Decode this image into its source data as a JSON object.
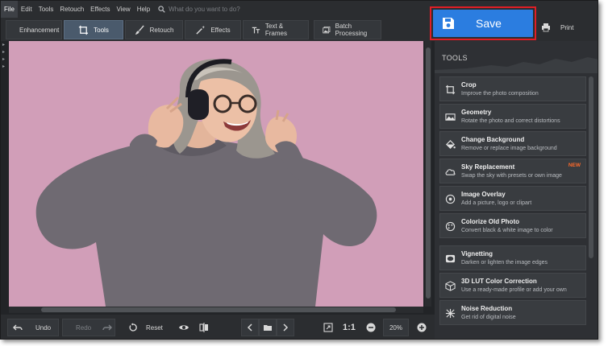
{
  "menu": {
    "items": [
      "File",
      "Edit",
      "Tools",
      "Retouch",
      "Effects",
      "View",
      "Help"
    ],
    "active": "File",
    "search_placeholder": "What do you want to do?"
  },
  "tabs": [
    {
      "label": "Enhancement",
      "icon": "sliders-icon"
    },
    {
      "label": "Tools",
      "icon": "crop-icon",
      "active": true
    },
    {
      "label": "Retouch",
      "icon": "brush-icon"
    },
    {
      "label": "Effects",
      "icon": "magic-wand-icon"
    },
    {
      "label": "Text & Frames",
      "icon": "text-icon"
    },
    {
      "label": "Batch Processing",
      "icon": "image-stack-icon"
    }
  ],
  "save": {
    "label": "Save",
    "icon": "floppy-disk-icon",
    "highlight_color": "#e01e26",
    "color": "#2b7de0"
  },
  "print": {
    "label": "Print",
    "icon": "printer-icon"
  },
  "panel": {
    "title": "TOOLS",
    "tools": [
      {
        "title": "Crop",
        "desc": "Improve the photo composition",
        "icon": "crop-icon"
      },
      {
        "title": "Geometry",
        "desc": "Rotate the photo and correct distortions",
        "icon": "geometry-icon"
      },
      {
        "title": "Change Background",
        "desc": "Remove or replace image background",
        "icon": "paint-bucket-icon"
      },
      {
        "title": "Sky Replacement",
        "desc": "Swap the sky with presets or own image",
        "icon": "cloud-icon",
        "badge": "NEW"
      },
      {
        "title": "Image Overlay",
        "desc": "Add a picture, logo or clipart",
        "icon": "overlay-icon"
      },
      {
        "title": "Colorize Old Photo",
        "desc": "Convert black & white image to color",
        "icon": "colorize-icon"
      },
      {
        "title": "Vignetting",
        "desc": "Darken or lighten the image edges",
        "icon": "vignette-icon"
      },
      {
        "title": "3D LUT Color Correction",
        "desc": "Use a ready-made profile or add your own",
        "icon": "lut-cube-icon"
      },
      {
        "title": "Noise Reduction",
        "desc": "Get rid of digital noise",
        "icon": "noise-icon"
      }
    ]
  },
  "bottom": {
    "undo": "Undo",
    "redo": "Redo",
    "reset": "Reset",
    "one_to_one": "1:1",
    "zoom": "20%"
  },
  "colors": {
    "photo_background": "#d19eb8",
    "panel": "#2e3034",
    "accent": "#2b7de0",
    "badge_new": "#ff6a2a"
  }
}
